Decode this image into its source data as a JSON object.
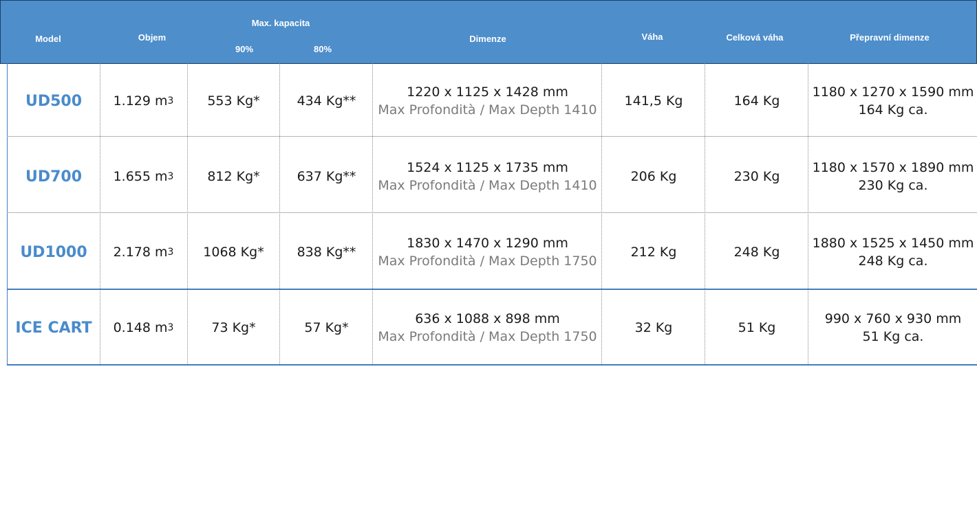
{
  "header": {
    "model": "Model",
    "objem": "Objem",
    "max_kapacita": "Max. kapacita",
    "cap90": "90%",
    "cap80": "80%",
    "dimenze": "Dimenze",
    "vaha": "Váha",
    "celkova_vaha": "Celková váha",
    "prepravni_dimenze": "Přepravní dimenze"
  },
  "rows": [
    {
      "model": "UD500",
      "volume": "1.129 m",
      "volume_exp": "3",
      "cap90": "553  Kg*",
      "cap80": "434  Kg**",
      "dim": "1220 x 1125 x 1428 mm",
      "dim_sub": "Max Profondità / Max Depth 1410",
      "weight": "141,5 Kg",
      "total_weight": "164 Kg",
      "ship_dim": "1180 x 1270 x 1590 mm",
      "ship_weight": "164 Kg ca."
    },
    {
      "model": "UD700",
      "volume": "1.655 m",
      "volume_exp": "3",
      "cap90": "812 Kg*",
      "cap80": "637 Kg**",
      "dim": "1524 x 1125 x 1735 mm",
      "dim_sub": "Max Profondità / Max Depth 1410",
      "weight": "206 Kg",
      "total_weight": "230 Kg",
      "ship_dim": "1180 x 1570 x 1890 mm",
      "ship_weight": "230 Kg ca."
    },
    {
      "model": "UD1000",
      "volume": "2.178 m",
      "volume_exp": "3",
      "cap90": "1068 Kg*",
      "cap80": "838 Kg**",
      "dim": "1830 x 1470 x 1290 mm",
      "dim_sub": "Max Profondità / Max Depth 1750",
      "weight": "212 Kg",
      "total_weight": "248 Kg",
      "ship_dim": "1880 x 1525 x 1450 mm",
      "ship_weight": "248 Kg ca."
    },
    {
      "model": "ICE CART",
      "volume": "0.148 m",
      "volume_exp": "3",
      "cap90": "73 Kg*",
      "cap80": "57 Kg*",
      "dim": "636 x 1088 x 898 mm",
      "dim_sub": "Max Profondità / Max Depth 1750",
      "weight": "32 Kg",
      "total_weight": "51 Kg",
      "ship_dim": "990 x 760 x 930 mm",
      "ship_weight": "51 Kg ca."
    }
  ],
  "colors": {
    "header_bg": "#4d8ecb",
    "model_text": "#4a8bcb",
    "subtext": "#7a7a7a"
  }
}
